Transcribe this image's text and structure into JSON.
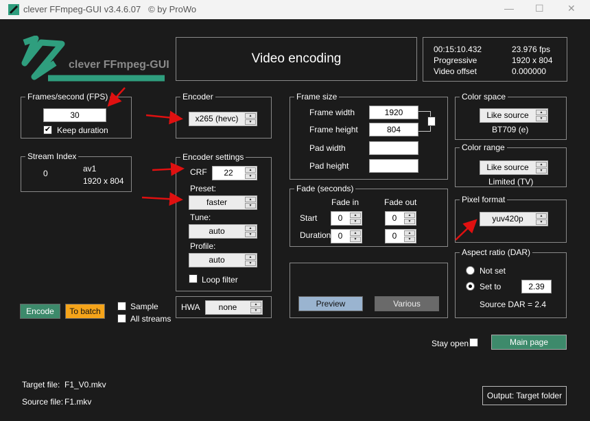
{
  "window": {
    "title": "clever FFmpeg-GUI v3.4.6.07",
    "copyright": "© by ProWo",
    "minimize": "—",
    "maximize": "☐",
    "close": "✕"
  },
  "logo": {
    "text": "clever FFmpeg-GUI",
    "color": "#2f9e7e"
  },
  "header": {
    "title": "Video encoding"
  },
  "info": {
    "duration": "00:15:10.432",
    "fps": "23.976 fps",
    "scan": "Progressive",
    "resolution": "1920 x 804",
    "offset_label": "Video offset",
    "offset": "0.000000"
  },
  "fps_group": {
    "label": "Frames/second (FPS)",
    "value": "30",
    "keep_duration": "Keep duration",
    "keep_duration_checked": true
  },
  "stream_index": {
    "label": "Stream Index",
    "index": "0",
    "codec": "av1",
    "resolution": "1920 x 804"
  },
  "encoder": {
    "label": "Encoder",
    "value": "x265 (hevc)"
  },
  "encoder_settings": {
    "label": "Encoder settings",
    "crf_label": "CRF",
    "crf": "22",
    "preset_label": "Preset:",
    "preset": "faster",
    "tune_label": "Tune:",
    "tune": "auto",
    "profile_label": "Profile:",
    "profile": "auto",
    "loop_filter": "Loop filter",
    "loop_filter_checked": false
  },
  "hwa": {
    "label": "HWA",
    "value": "none"
  },
  "frame_size": {
    "label": "Frame size",
    "width_label": "Frame width",
    "width": "1920",
    "height_label": "Frame height",
    "height": "804",
    "pad_width_label": "Pad width",
    "pad_width": "",
    "pad_height_label": "Pad height",
    "pad_height": ""
  },
  "fade": {
    "label": "Fade (seconds)",
    "fade_in": "Fade in",
    "fade_out": "Fade out",
    "start": "Start",
    "duration": "Duration",
    "start_in": "0",
    "start_out": "0",
    "dur_in": "0",
    "dur_out": "0"
  },
  "preview": {
    "preview_label": "Preview",
    "various_label": "Various"
  },
  "color_space": {
    "label": "Color space",
    "value": "Like source",
    "info": "BT709 (e)"
  },
  "color_range": {
    "label": "Color range",
    "value": "Like source",
    "info": "Limited (TV)"
  },
  "pixel_format": {
    "label": "Pixel format",
    "value": "yuv420p"
  },
  "aspect": {
    "label": "Aspect ratio (DAR)",
    "not_set": "Not set",
    "set_to": "Set to",
    "selected": "Set to",
    "value": "2.39",
    "source": "Source DAR = 2.4"
  },
  "actions": {
    "encode": "Encode",
    "to_batch": "To batch",
    "sample": "Sample",
    "all_streams": "All streams",
    "stay_open": "Stay open",
    "main_page": "Main page",
    "output": "Output: Target folder"
  },
  "files": {
    "target_label": "Target file:",
    "target": "F1_V0.mkv",
    "source_label": "Source file:",
    "source": "F1.mkv"
  },
  "colors": {
    "encode": "#3d8a6b",
    "to_batch": "#f5a41a",
    "preview": "#9ab4d0",
    "various": "#6a6a6a",
    "arrow": "#e01010"
  }
}
